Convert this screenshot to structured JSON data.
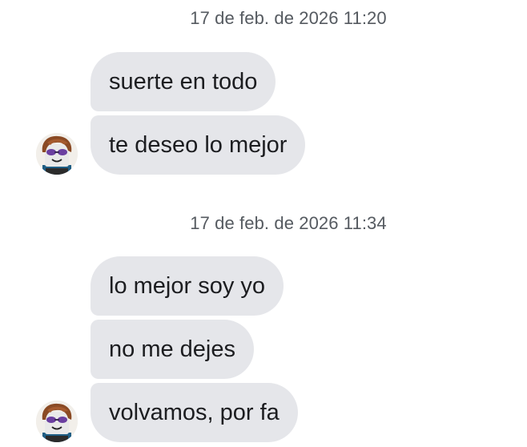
{
  "groups": [
    {
      "timestamp": "17 de feb. de 2026 11:20",
      "messages": [
        "suerte en todo",
        "te deseo lo mejor"
      ]
    },
    {
      "timestamp": "17 de feb. de 2026 11:34",
      "messages": [
        "lo mejor soy yo",
        "no me dejes",
        "volvamos, por fa"
      ]
    }
  ],
  "avatar": {
    "icon": "roblox-avatar-icon"
  },
  "colors": {
    "bubble_background": "#e5e6ea",
    "bubble_text": "#1c1d20",
    "timestamp_text": "#555a60",
    "background": "#ffffff"
  }
}
